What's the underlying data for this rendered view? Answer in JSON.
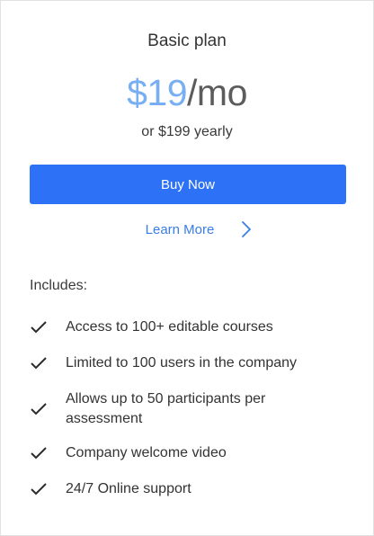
{
  "plan": {
    "name": "Basic plan",
    "price_amount": "$19",
    "price_period": "/mo",
    "price_yearly": "or $199 yearly"
  },
  "actions": {
    "buy_label": "Buy Now",
    "learn_more_label": "Learn More"
  },
  "includes": {
    "label": "Includes:",
    "items": [
      "Access to 100+ editable courses",
      "Limited to 100 users in the company",
      "Allows up to 50 participants per assessment",
      "Company welcome video",
      "24/7 Online support"
    ]
  },
  "colors": {
    "price_accent": "#78aef2",
    "button_bg": "#2d72f6",
    "link": "#3a7de8"
  },
  "icons": {
    "learn_more": "chevron-right-icon",
    "feature": "checkmark-icon"
  }
}
